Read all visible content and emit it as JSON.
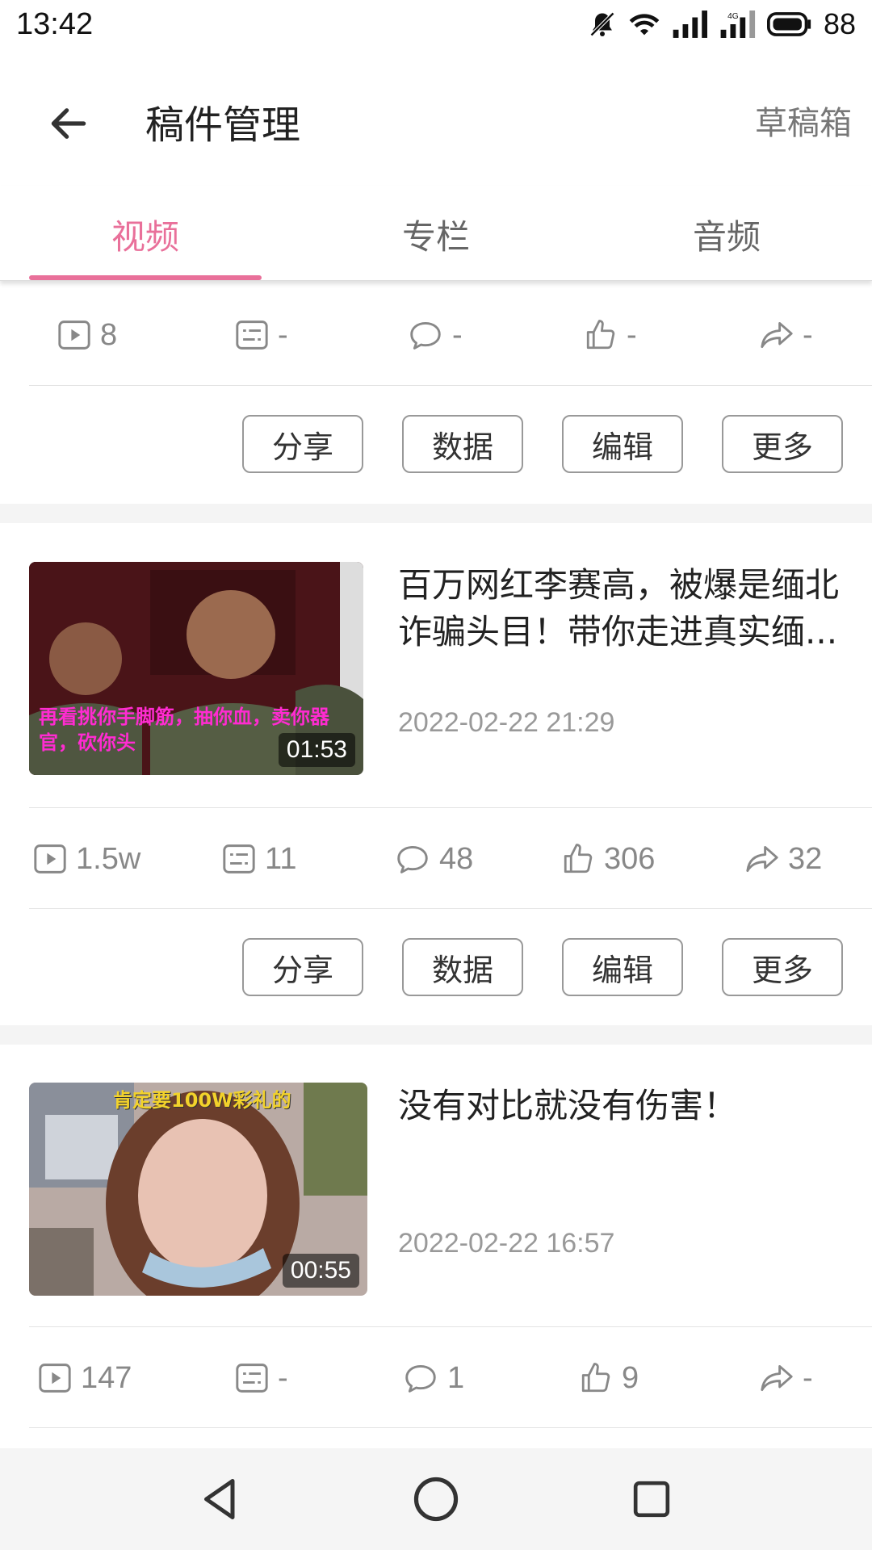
{
  "status_bar": {
    "time": "13:42",
    "battery": "88",
    "icons": [
      "mute-icon",
      "wifi-icon",
      "signal-icon",
      "signal-4g-icon",
      "battery-icon"
    ]
  },
  "header": {
    "title": "稿件管理",
    "drafts_label": "草稿箱"
  },
  "tabs": [
    {
      "label": "视频",
      "active": true
    },
    {
      "label": "专栏",
      "active": false
    },
    {
      "label": "音频",
      "active": false
    }
  ],
  "accent_color": "#e9709a",
  "actions": {
    "share": "分享",
    "data": "数据",
    "edit": "编辑",
    "more": "更多"
  },
  "stat_icons": [
    "play-icon",
    "danmaku-icon",
    "comment-icon",
    "like-icon",
    "share-icon"
  ],
  "top_item": {
    "stats": {
      "plays": "8",
      "danmaku": "-",
      "comments": "-",
      "likes": "-",
      "shares": "-"
    }
  },
  "items": [
    {
      "title": "百万网红李赛高，被爆是缅北诈骗头目！带你走进真实缅...",
      "date": "2022-02-22 21:29",
      "duration": "01:53",
      "thumb_caption": "再看挑你手脚筋，抽你血，卖你器官，砍你头",
      "stats": {
        "plays": "1.5w",
        "danmaku": "11",
        "comments": "48",
        "likes": "306",
        "shares": "32"
      }
    },
    {
      "title": "没有对比就没有伤害！",
      "date": "2022-02-22 16:57",
      "duration": "00:55",
      "thumb_caption": "肯定要100W彩礼的",
      "stats": {
        "plays": "147",
        "danmaku": "-",
        "comments": "1",
        "likes": "9",
        "shares": "-"
      }
    }
  ],
  "nav": [
    "back-nav-icon",
    "home-nav-icon",
    "recents-nav-icon"
  ]
}
